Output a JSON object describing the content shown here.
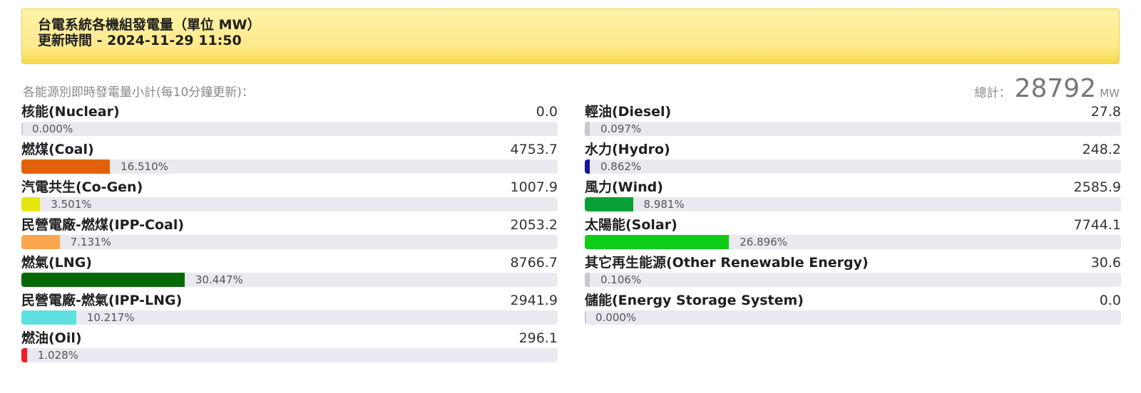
{
  "header": {
    "title": "台電系統各機組發電量（單位 MW）",
    "update": "更新時間 - 2024-11-29 11:50"
  },
  "subtitle": "各能源別即時發電量小計(每10分鐘更新)：",
  "total": {
    "label": "總計：",
    "value": "28792",
    "unit": "MW"
  },
  "left": [
    {
      "name": "核能(Nuclear)",
      "value": "0.0",
      "percent_text": "0.000%",
      "percent": 0.0,
      "color": "#c8c8d0"
    },
    {
      "name": "燃煤(Coal)",
      "value": "4753.7",
      "percent_text": "16.510%",
      "percent": 16.51,
      "color": "#e2620b"
    },
    {
      "name": "汽電共生(Co-Gen)",
      "value": "1007.9",
      "percent_text": "3.501%",
      "percent": 3.501,
      "color": "#e6e60e"
    },
    {
      "name": "民營電廠-燃煤(IPP-Coal)",
      "value": "2053.2",
      "percent_text": "7.131%",
      "percent": 7.131,
      "color": "#fba54c"
    },
    {
      "name": "燃氣(LNG)",
      "value": "8766.7",
      "percent_text": "30.447%",
      "percent": 30.447,
      "color": "#056806"
    },
    {
      "name": "民營電廠-燃氣(IPP-LNG)",
      "value": "2941.9",
      "percent_text": "10.217%",
      "percent": 10.217,
      "color": "#5fe0e0"
    },
    {
      "name": "燃油(Oil)",
      "value": "296.1",
      "percent_text": "1.028%",
      "percent": 1.028,
      "color": "#ee1c24"
    }
  ],
  "right": [
    {
      "name": "輕油(Diesel)",
      "value": "27.8",
      "percent_text": "0.097%",
      "percent": 0.097,
      "color": "#c8c8d0"
    },
    {
      "name": "水力(Hydro)",
      "value": "248.2",
      "percent_text": "0.862%",
      "percent": 0.862,
      "color": "#1515a0"
    },
    {
      "name": "風力(Wind)",
      "value": "2585.9",
      "percent_text": "8.981%",
      "percent": 8.981,
      "color": "#08a035"
    },
    {
      "name": "太陽能(Solar)",
      "value": "7744.1",
      "percent_text": "26.896%",
      "percent": 26.896,
      "color": "#0ecc17"
    },
    {
      "name": "其它再生能源(Other Renewable Energy)",
      "value": "30.6",
      "percent_text": "0.106%",
      "percent": 0.106,
      "color": "#c8c8d0"
    },
    {
      "name": "儲能(Energy Storage System)",
      "value": "0.0",
      "percent_text": "0.000%",
      "percent": 0.0,
      "color": "#c8c8d0"
    }
  ]
}
